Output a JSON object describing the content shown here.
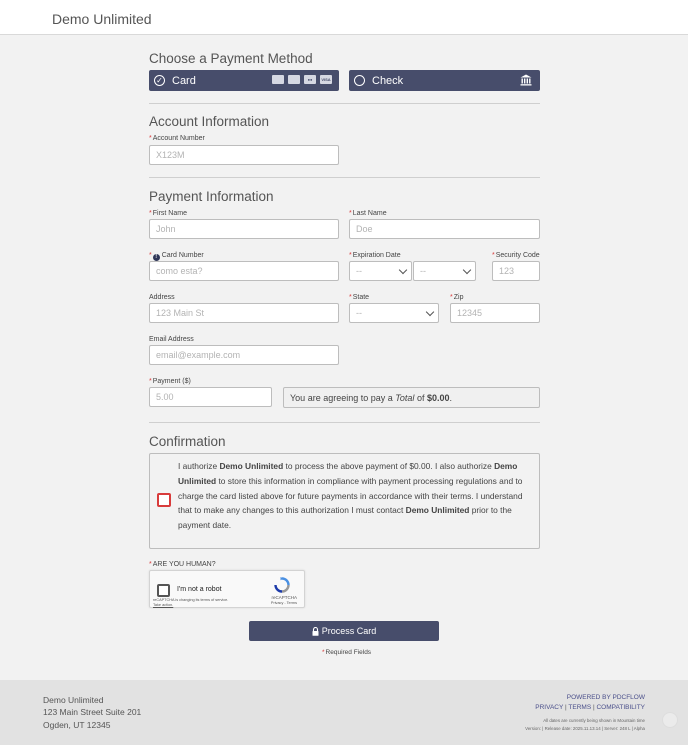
{
  "header": {
    "brand": "Demo Unlimited"
  },
  "payment_method": {
    "title": "Choose a Payment Method",
    "card_label": "Card",
    "check_label": "Check",
    "card_icons": [
      "discover",
      "amex",
      "mastercard",
      "visa"
    ],
    "visa_text": "VISA"
  },
  "account": {
    "title": "Account Information",
    "account_number_label": "Account Number",
    "account_number_placeholder": "X123M"
  },
  "payment_info": {
    "title": "Payment Information",
    "first_name_label": "First Name",
    "first_name_placeholder": "John",
    "last_name_label": "Last Name",
    "last_name_placeholder": "Doe",
    "card_number_label": "Card Number",
    "card_number_placeholder": "como esta?",
    "expiration_label": "Expiration Date",
    "exp_month_value": "--",
    "exp_year_value": "--",
    "security_code_label": "Security Code",
    "security_code_placeholder": "123",
    "address_label": "Address",
    "address_placeholder": "123 Main St",
    "state_label": "State",
    "state_value": "--",
    "zip_label": "Zip",
    "zip_placeholder": "12345",
    "email_label": "Email Address",
    "email_placeholder": "email@example.com",
    "payment_label": "Payment ($)",
    "payment_placeholder": "5.00",
    "agree_prefix": "You are agreeing to pay a ",
    "agree_total_word": "Total",
    "agree_mid": " of ",
    "agree_amount": "$0.00",
    "agree_suffix": "."
  },
  "confirmation": {
    "title": "Confirmation",
    "t1": "I authorize ",
    "b1": "Demo Unlimited",
    "t2": " to process the above payment of $0.00. I also authorize ",
    "b2": "Demo Unlimited",
    "t3": " to store this information in compliance with payment processing regulations and to charge the card listed above for future payments in accordance with their terms. I understand that to make any changes to this authorization I must contact ",
    "b3": "Demo Unlimited",
    "t4": " prior to the payment date."
  },
  "captcha": {
    "label": "ARE YOU HUMAN?",
    "text": "I'm not a robot",
    "notice": "reCAPTCHA is changing its terms of service.",
    "notice_link": "Take action.",
    "brand": "reCAPTCHA",
    "links": "Privacy - Terms"
  },
  "actions": {
    "process_label": "Process Card",
    "required_note": "Required Fields"
  },
  "footer": {
    "company": "Demo Unlimited",
    "address1": "123 Main Street Suite 201",
    "address2": "Ogden, UT 12345",
    "powered": "POWERED BY PDCFLOW",
    "privacy": "PRIVACY",
    "terms": "TERMS",
    "compatibility": "COMPATIBILITY",
    "meta1": "All dates are currently being shown in Mountain time",
    "meta2": "Version: | Release date: 2025.11.13.14 | Server: 248 L | Alpha"
  },
  "colors": {
    "primary": "#474d6b",
    "required": "#d83b3b",
    "link": "#4a4f8a"
  }
}
